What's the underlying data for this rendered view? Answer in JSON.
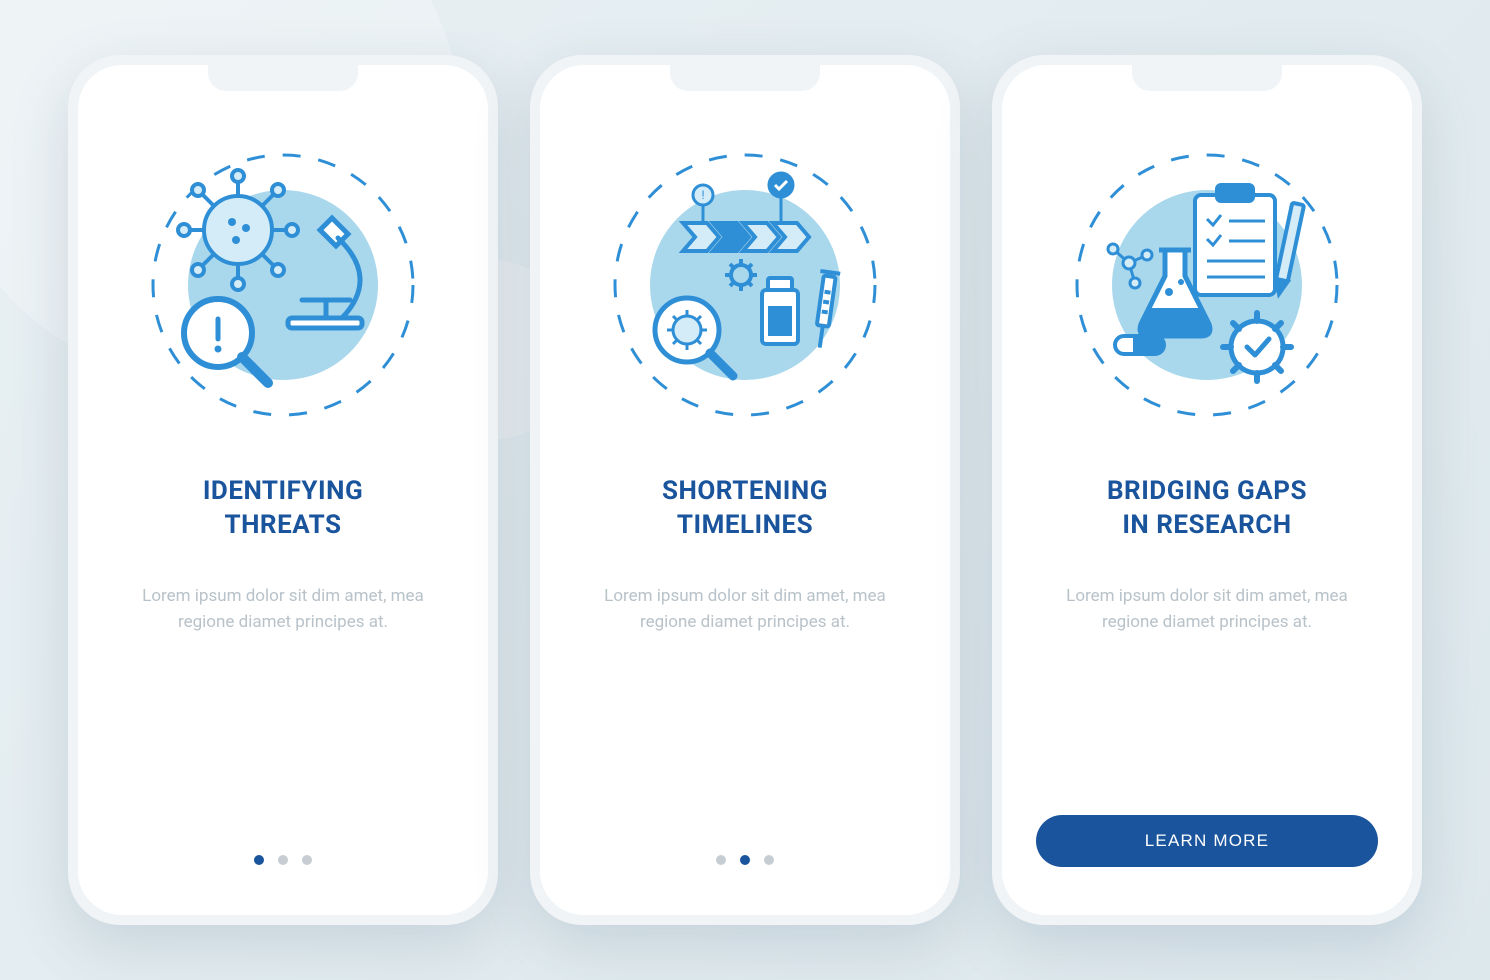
{
  "colors": {
    "primary": "#1a549c",
    "accent": "#2f8fd6",
    "light": "#a9d8ed",
    "muted": "#b8c2c9"
  },
  "screens": [
    {
      "title": "IDENTIFYING\nTHREATS",
      "description": "Lorem ipsum dolor sit dim amet, mea regione diamet principes at.",
      "icon": "virus-microscope",
      "active_dot": 0,
      "show_dots": true,
      "show_button": false
    },
    {
      "title": "SHORTENING\nTIMELINES",
      "description": "Lorem ipsum dolor sit dim amet, mea regione diamet principes at.",
      "icon": "timeline-vaccine",
      "active_dot": 1,
      "show_dots": true,
      "show_button": false
    },
    {
      "title": "BRIDGING GAPS\nIN RESEARCH",
      "description": "Lorem ipsum dolor sit dim amet, mea regione diamet principes at.",
      "icon": "research-clipboard",
      "active_dot": 2,
      "show_dots": false,
      "show_button": true,
      "button_label": "LEARN MORE"
    }
  ],
  "dot_count": 3
}
